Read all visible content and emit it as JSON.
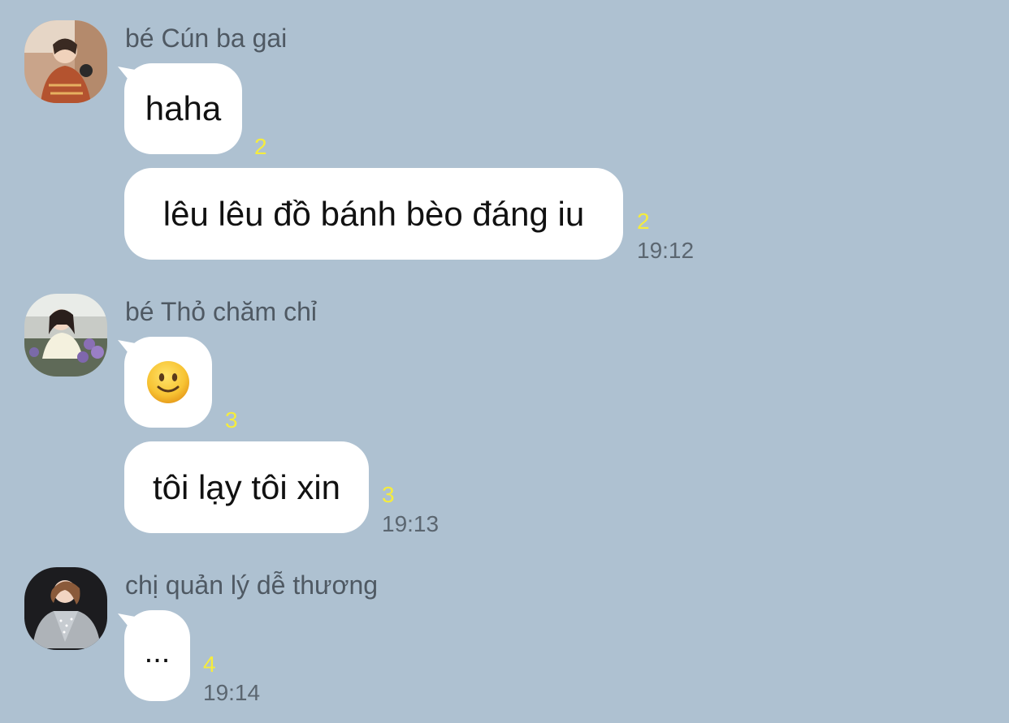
{
  "background_color": "#aec1d1",
  "read_count_color": "#f5ec3d",
  "groups": [
    {
      "sender": "bé Cún ba gai",
      "avatar_icon": "avatar-photo",
      "messages": [
        {
          "text": "haha",
          "read_count": "2"
        },
        {
          "text": "lêu lêu đồ bánh bèo đáng iu",
          "read_count": "2",
          "time": "19:12"
        }
      ]
    },
    {
      "sender": "bé Thỏ chăm chỉ",
      "avatar_icon": "avatar-photo",
      "messages": [
        {
          "text": "🙂",
          "emoji_icon": "slightly-smiling-face-icon",
          "read_count": "3"
        },
        {
          "text": "tôi lạy tôi xin",
          "read_count": "3",
          "time": "19:13"
        }
      ]
    },
    {
      "sender": "chị quản lý dễ thương",
      "avatar_icon": "avatar-photo",
      "messages": [
        {
          "text": "...",
          "read_count": "4",
          "time": "19:14"
        }
      ]
    }
  ]
}
